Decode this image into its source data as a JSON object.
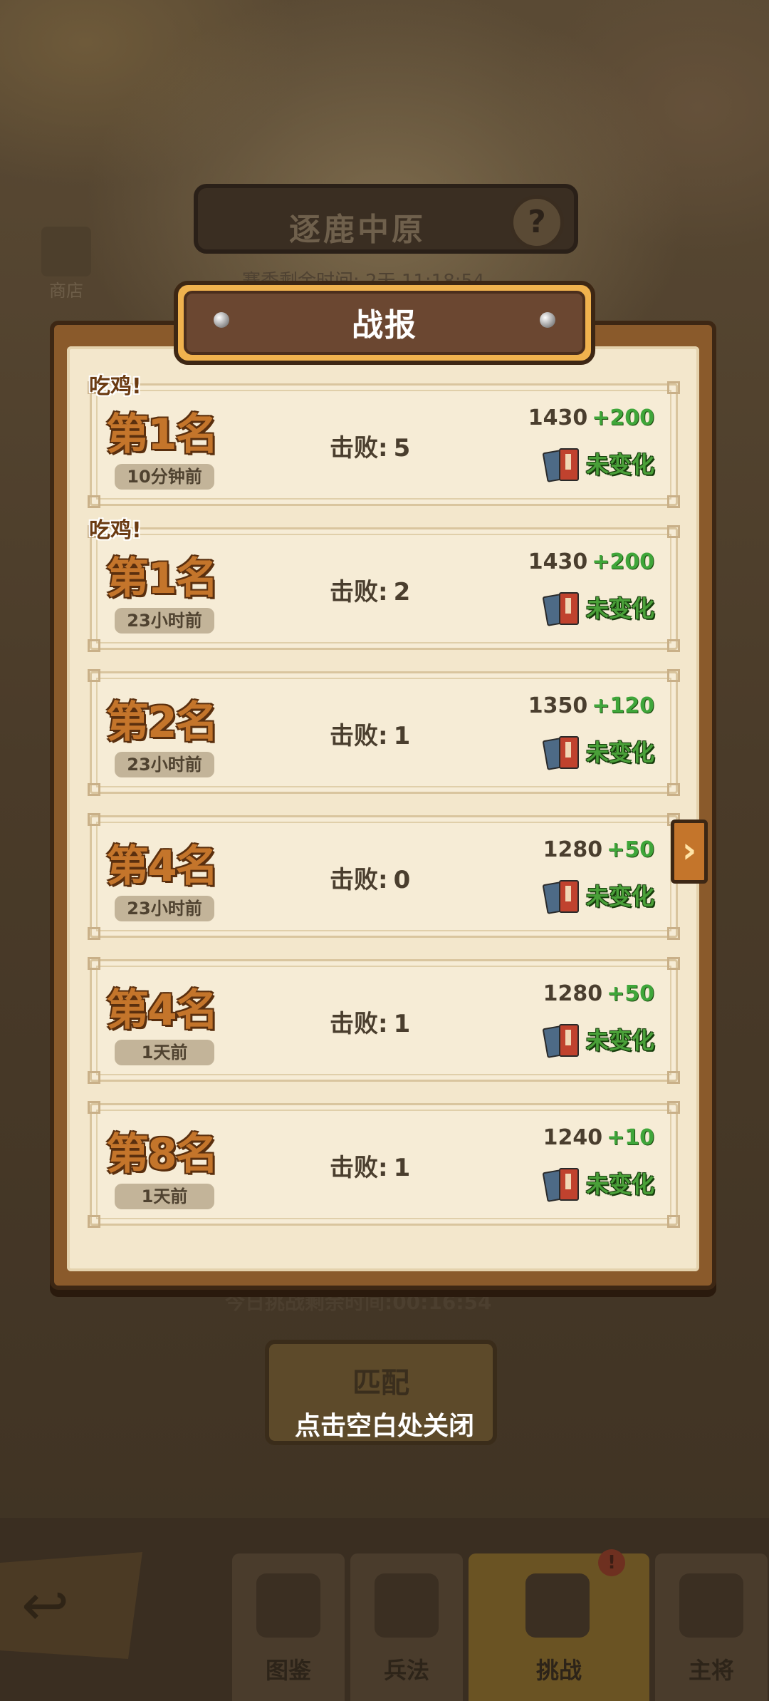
{
  "background": {
    "mode_title": "逐鹿中原",
    "help_label": "?",
    "shop_label": "商店",
    "season_text": "赛季剩余时间: 2天 11:18:54",
    "challenge_timer": "今日挑战剩余时间:00:16:54",
    "match_button": "匹配"
  },
  "close_hint": "点击空白处关闭",
  "modal": {
    "title": "战报",
    "side_arrow": "›"
  },
  "reports": [
    {
      "tag": "吃鸡!",
      "rank": "第1名",
      "time": "10分钟前",
      "kills_label": "击败:",
      "kills": "5",
      "score": "1430",
      "delta": "+200",
      "status": "未变化"
    },
    {
      "tag": "吃鸡!",
      "rank": "第1名",
      "time": "23小时前",
      "kills_label": "击败:",
      "kills": "2",
      "score": "1430",
      "delta": "+200",
      "status": "未变化"
    },
    {
      "tag": "",
      "rank": "第2名",
      "time": "23小时前",
      "kills_label": "击败:",
      "kills": "1",
      "score": "1350",
      "delta": "+120",
      "status": "未变化"
    },
    {
      "tag": "",
      "rank": "第4名",
      "time": "23小时前",
      "kills_label": "击败:",
      "kills": "0",
      "score": "1280",
      "delta": "+50",
      "status": "未变化"
    },
    {
      "tag": "",
      "rank": "第4名",
      "time": "1天前",
      "kills_label": "击败:",
      "kills": "1",
      "score": "1280",
      "delta": "+50",
      "status": "未变化"
    },
    {
      "tag": "",
      "rank": "第8名",
      "time": "1天前",
      "kills_label": "击败:",
      "kills": "1",
      "score": "1240",
      "delta": "+10",
      "status": "未变化"
    }
  ],
  "bottom_nav": {
    "back": "↩",
    "tabs": [
      {
        "label": "图鉴",
        "icon": "house-icon"
      },
      {
        "label": "兵法",
        "icon": "scroll-icon"
      },
      {
        "label": "挑战",
        "icon": "crossed-swords-icon",
        "badge": "!"
      },
      {
        "label": "主将",
        "icon": "general-icon"
      }
    ]
  },
  "colors": {
    "rank_text": "#c4752b",
    "delta_green": "#3fa63a",
    "status_green": "#4aa039",
    "paper": "#f3e7cc",
    "panel_wood": "#8a5a2b"
  }
}
